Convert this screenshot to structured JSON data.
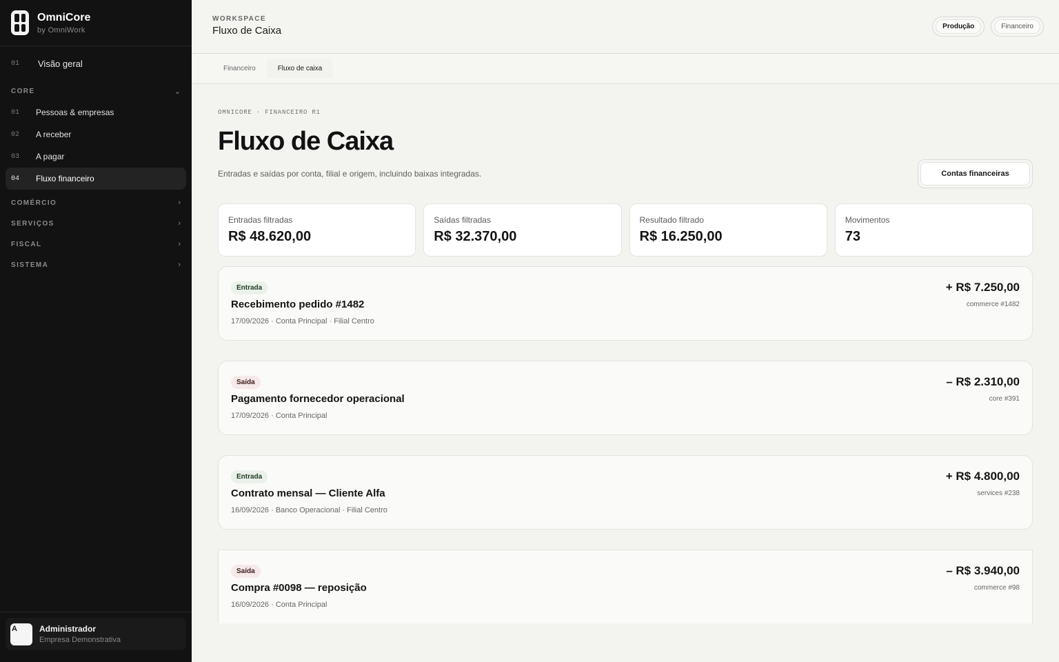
{
  "brand": {
    "name": "OmniCore",
    "sub": "by OmniWork"
  },
  "nav": {
    "overview": {
      "num": "01",
      "label": "Visão geral"
    },
    "sections": [
      {
        "title": "CORE",
        "expanded": true,
        "items": [
          {
            "num": "01",
            "label": "Pessoas & empresas"
          },
          {
            "num": "02",
            "label": "A receber"
          },
          {
            "num": "03",
            "label": "A pagar"
          },
          {
            "num": "04",
            "label": "Fluxo financeiro",
            "active": true
          }
        ]
      },
      {
        "title": "COMÉRCIO",
        "expanded": false
      },
      {
        "title": "SERVIÇOS",
        "expanded": false
      },
      {
        "title": "FISCAL",
        "expanded": false
      },
      {
        "title": "SISTEMA",
        "expanded": false
      }
    ]
  },
  "user": {
    "initial": "A",
    "name": "Administrador",
    "company": "Empresa Demonstrativa"
  },
  "header": {
    "workspace_label": "WORKSPACE",
    "title": "Fluxo de Caixa",
    "buttons": [
      "Produção",
      "Financeiro"
    ]
  },
  "tabs": [
    "Financeiro",
    "Fluxo de caixa"
  ],
  "page": {
    "breadcrumb": "OMNICORE · FINANCEIRO R1",
    "title": "Fluxo de Caixa",
    "description": "Entradas e saídas por conta, filial e origem, incluindo baixas integradas.",
    "action_label": "Contas financeiras"
  },
  "stats": [
    {
      "label": "Entradas filtradas",
      "value": "R$ 48.620,00"
    },
    {
      "label": "Saídas filtradas",
      "value": "R$ 32.370,00"
    },
    {
      "label": "Resultado filtrado",
      "value": "R$ 16.250,00"
    },
    {
      "label": "Movimentos",
      "value": "73"
    }
  ],
  "transactions": [
    {
      "type": "in",
      "badge": "Entrada",
      "title": "Recebimento pedido #1482",
      "meta": "17/09/2026 · Conta Principal · Filial Centro",
      "amount": "+ R$ 7.250,00",
      "ref": "commerce #1482"
    },
    {
      "type": "out",
      "badge": "Saída",
      "title": "Pagamento fornecedor operacional",
      "meta": "17/09/2026 · Conta Principal",
      "amount": "– R$ 2.310,00",
      "ref": "core #391"
    },
    {
      "type": "in",
      "badge": "Entrada",
      "title": "Contrato mensal — Cliente Alfa",
      "meta": "16/09/2026 · Banco Operacional · Filial Centro",
      "amount": "+ R$ 4.800,00",
      "ref": "services #238"
    },
    {
      "type": "out",
      "badge": "Saída",
      "title": "Compra #0098 — reposição",
      "meta": "16/09/2026 · Conta Principal",
      "amount": "– R$ 3.940,00",
      "ref": "commerce #98"
    }
  ],
  "colors": {
    "sidebar_bg": "#121212",
    "page_bg": "#f3f3f0",
    "badge_in": "#eaf1ea",
    "badge_out": "#f6e9e9"
  }
}
